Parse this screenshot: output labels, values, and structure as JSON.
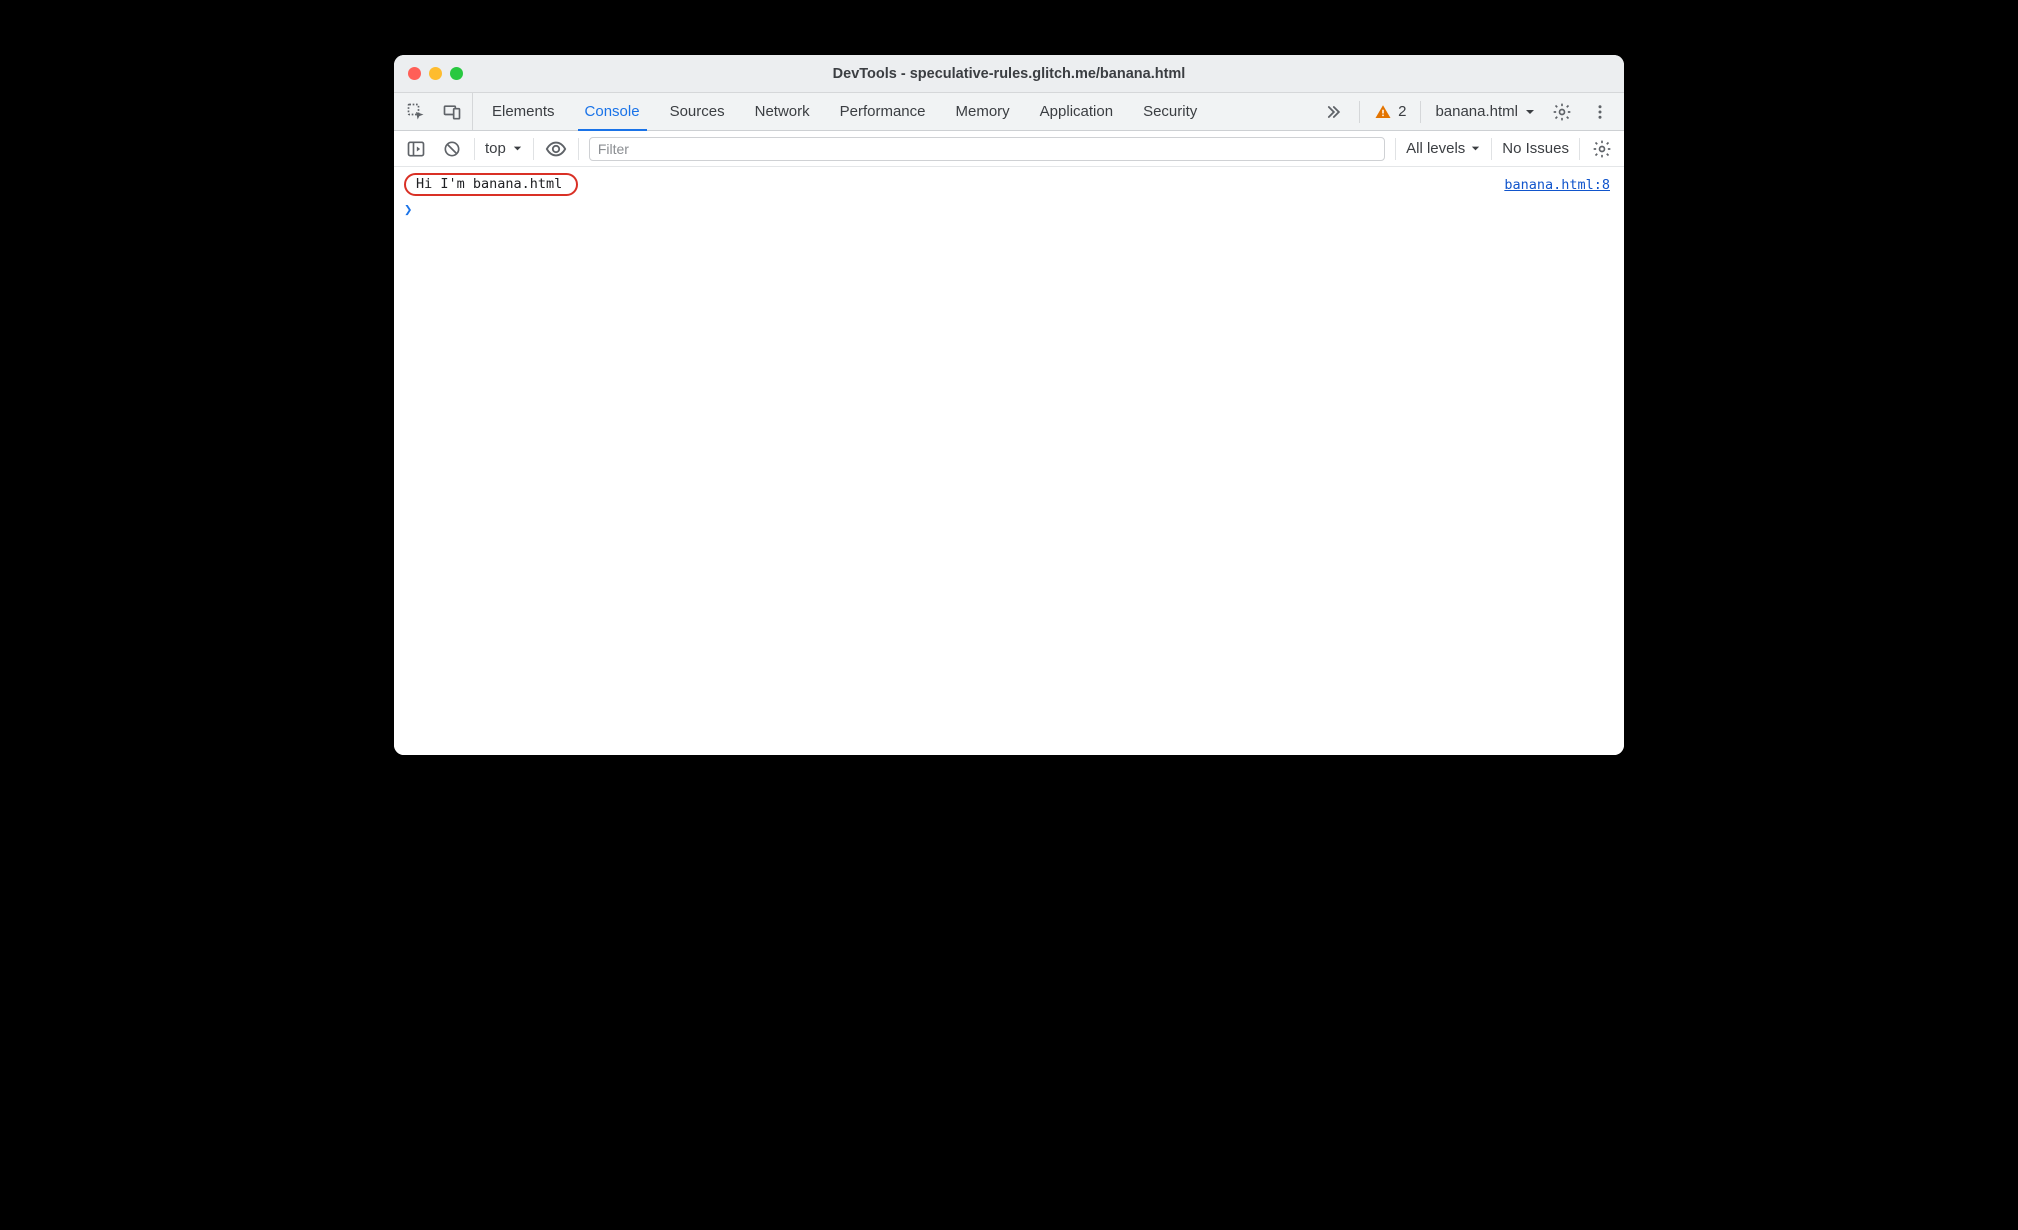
{
  "window": {
    "title": "DevTools - speculative-rules.glitch.me/banana.html"
  },
  "tabs": {
    "items": [
      {
        "label": "Elements"
      },
      {
        "label": "Console"
      },
      {
        "label": "Sources"
      },
      {
        "label": "Network"
      },
      {
        "label": "Performance"
      },
      {
        "label": "Memory"
      },
      {
        "label": "Application"
      },
      {
        "label": "Security"
      }
    ],
    "active_index": 1,
    "warning_count": "2",
    "context_label": "banana.html"
  },
  "console_toolbar": {
    "context": "top",
    "filter_placeholder": "Filter",
    "filter_value": "",
    "levels_label": "All levels",
    "issues_label": "No Issues"
  },
  "console": {
    "logs": [
      {
        "message": "Hi I'm banana.html",
        "source": "banana.html:8"
      }
    ]
  }
}
